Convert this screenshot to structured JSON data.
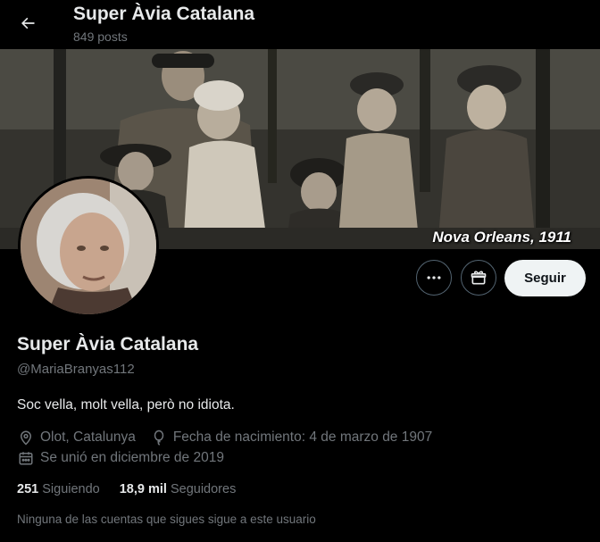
{
  "header": {
    "title": "Super Àvia Catalana",
    "posts": "849 posts"
  },
  "banner": {
    "caption": "Nova Orleans, 1911"
  },
  "actions": {
    "follow_label": "Seguir",
    "more_icon": "more-icon",
    "gift_icon": "gift-icon"
  },
  "profile": {
    "name": "Super Àvia Catalana",
    "handle": "@MariaBranyas112",
    "bio": "Soc vella, molt vella, però no idiota.",
    "location": "Olot, Catalunya",
    "birth": "Fecha de nacimiento: 4 de marzo de 1907",
    "joined": "Se unió en diciembre de 2019"
  },
  "stats": {
    "following_count": "251",
    "following_label": "Siguiendo",
    "followers_count": "18,9 mil",
    "followers_label": "Seguidores"
  },
  "notice": "Ninguna de las cuentas que sigues sigue a este usuario",
  "colors": {
    "background": "#000000",
    "text_primary": "#e7e9ea",
    "text_secondary": "#71767b",
    "follow_bg": "#eff3f4"
  }
}
